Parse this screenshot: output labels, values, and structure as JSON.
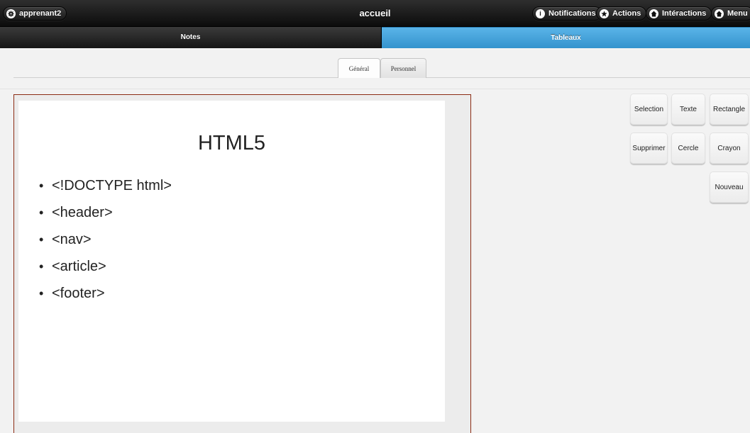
{
  "header": {
    "user": "apprenant2",
    "title": "accueil",
    "buttons": {
      "notifications": "Notifications",
      "actions": "Actions",
      "interactions": "Intéractions",
      "menu": "Menu"
    }
  },
  "nav": {
    "notes": "Notes",
    "tableaux": "Tableaux"
  },
  "tabs": {
    "general": "Général",
    "personnel": "Personnel"
  },
  "slide": {
    "title": "HTML5",
    "items": [
      "<!DOCTYPE html>",
      "<header>",
      "<nav>",
      "<article>",
      "<footer>"
    ]
  },
  "tools": {
    "selection": "Selection",
    "texte": "Texte",
    "rectangle": "Rectangle",
    "supprimer": "Supprimer",
    "cercle": "Cercle",
    "crayon": "Crayon",
    "nouveau": "Nouveau"
  },
  "colors": {
    "header_bg": "#1a1a1a",
    "active_tab": "#3c9ad4",
    "panel_border": "#8b2c14"
  },
  "icons": {
    "user": "gear-icon",
    "notifications": "info-icon",
    "actions": "star-icon",
    "interactions": "home-icon",
    "menu": "home-icon"
  }
}
